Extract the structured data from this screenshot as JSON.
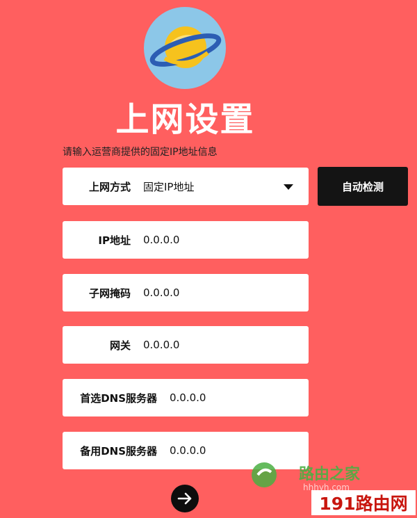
{
  "title": "上网设置",
  "hint": "请输入运营商提供的固定IP地址信息",
  "fields": [
    {
      "label": "上网方式",
      "value": "固定IP地址"
    },
    {
      "label": "IP地址",
      "value": "0.0.0.0"
    },
    {
      "label": "子网掩码",
      "value": "0.0.0.0"
    },
    {
      "label": "网关",
      "value": "0.0.0.0"
    },
    {
      "label": "首选DNS服务器",
      "value": "0.0.0.0"
    },
    {
      "label": "备用DNS服务器",
      "value": "0.0.0.0"
    }
  ],
  "auto_detect_label": "自动检测",
  "watermark": {
    "brand": "路由之家",
    "site_partial": "hhhyh.com",
    "box_text": "191路由网"
  },
  "colors": {
    "background": "#ff5f5f",
    "button": "#141414",
    "planet_bg": "#8cc7e8",
    "planet": "#f6c21d",
    "ring": "#2c5db3"
  },
  "icons": {
    "logo": "planet-icon",
    "dropdown": "caret-down-icon",
    "next": "arrow-right-icon"
  }
}
